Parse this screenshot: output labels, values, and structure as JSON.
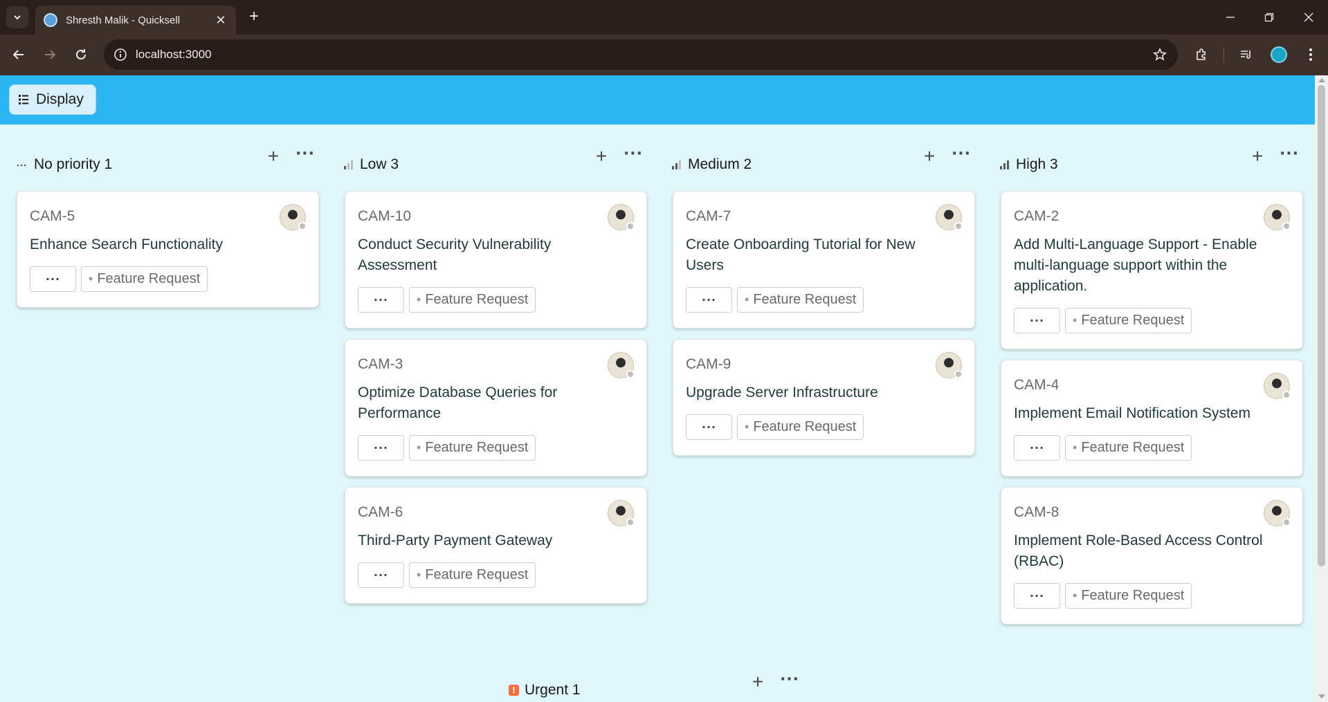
{
  "browser": {
    "tab_title": "Shresth Malik - Quicksell",
    "url": "localhost:3000"
  },
  "app": {
    "display_button_label": "Display"
  },
  "columns": [
    {
      "label": "No priority 1",
      "icon": "dots-icon",
      "cards": [
        {
          "id": "CAM-5",
          "title": "Enhance Search Functionality",
          "tag": "Feature Request"
        }
      ]
    },
    {
      "label": "Low 3",
      "icon": "signal-low-icon",
      "cards": [
        {
          "id": "CAM-10",
          "title": "Conduct Security Vulnerability Assessment",
          "tag": "Feature Request"
        },
        {
          "id": "CAM-3",
          "title": "Optimize Database Queries for Performance",
          "tag": "Feature Request"
        },
        {
          "id": "CAM-6",
          "title": "Third-Party Payment Gateway",
          "tag": "Feature Request"
        }
      ]
    },
    {
      "label": "Medium 2",
      "icon": "signal-medium-icon",
      "cards": [
        {
          "id": "CAM-7",
          "title": "Create Onboarding Tutorial for New Users",
          "tag": "Feature Request"
        },
        {
          "id": "CAM-9",
          "title": "Upgrade Server Infrastructure",
          "tag": "Feature Request"
        }
      ]
    },
    {
      "label": "High 3",
      "icon": "signal-high-icon",
      "cards": [
        {
          "id": "CAM-2",
          "title": "Add Multi-Language Support - Enable multi-language support within the application.",
          "tag": "Feature Request"
        },
        {
          "id": "CAM-4",
          "title": "Implement Email Notification System",
          "tag": "Feature Request"
        },
        {
          "id": "CAM-8",
          "title": "Implement Role-Based Access Control (RBAC)",
          "tag": "Feature Request"
        }
      ]
    },
    {
      "label": "Urgent 1",
      "icon": "urgent-icon",
      "cards": []
    }
  ],
  "colors": {
    "header_bg": "#2bb6f3",
    "board_bg": "#dff6fa",
    "urgent": "#fa6d3a"
  }
}
